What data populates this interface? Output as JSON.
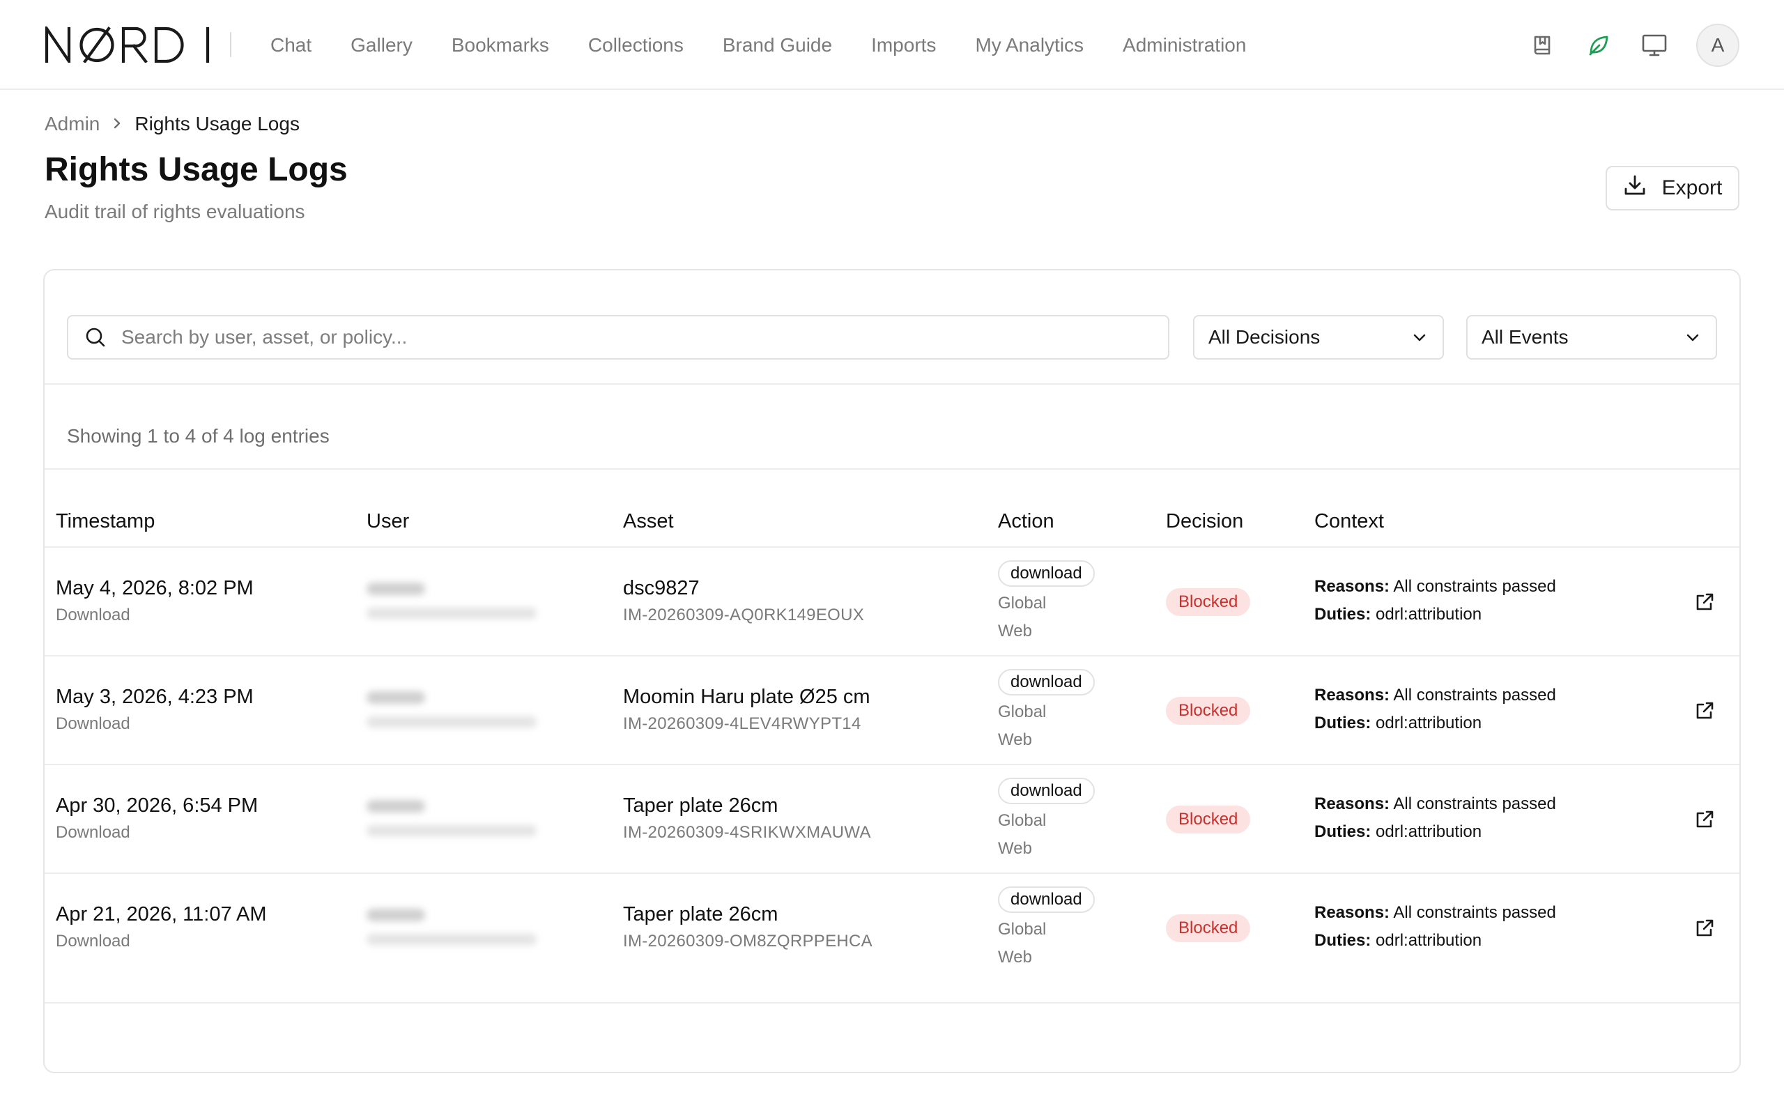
{
  "app": {
    "logo_text": "NØRDI",
    "nav": [
      "Chat",
      "Gallery",
      "Bookmarks",
      "Collections",
      "Brand Guide",
      "Imports",
      "My Analytics",
      "Administration"
    ],
    "icons": [
      "book-icon",
      "leaf-icon",
      "monitor-icon"
    ],
    "accent_color": "#1f9d55",
    "avatar_initial": "A"
  },
  "breadcrumb": {
    "root": "Admin",
    "separator": "›",
    "current": "Rights Usage Logs"
  },
  "page": {
    "title": "Rights Usage Logs",
    "subtitle": "Audit trail of rights evaluations",
    "export_label": "Export"
  },
  "filters": {
    "search_placeholder": "Search by user, asset, or policy...",
    "decision_selected": "All Decisions",
    "event_selected": "All Events"
  },
  "summary": "Showing 1 to 4 of 4 log entries",
  "table": {
    "columns": [
      "Timestamp",
      "User",
      "Asset",
      "Action",
      "Decision",
      "Context"
    ],
    "rows": [
      {
        "timestamp": "May 4, 2026, 8:02 PM",
        "event": "Download",
        "asset_name": "dsc9827",
        "asset_id": "IM-20260309-AQ0RK149EOUX",
        "action": "download",
        "scope": "Global",
        "channel": "Web",
        "decision": "Blocked",
        "reasons_label": "Reasons:",
        "reasons": "All constraints passed",
        "duties_label": "Duties:",
        "duties": "odrl:attribution"
      },
      {
        "timestamp": "May 3, 2026, 4:23 PM",
        "event": "Download",
        "asset_name": "Moomin Haru plate Ø25 cm",
        "asset_id": "IM-20260309-4LEV4RWYPT14",
        "action": "download",
        "scope": "Global",
        "channel": "Web",
        "decision": "Blocked",
        "reasons_label": "Reasons:",
        "reasons": "All constraints passed",
        "duties_label": "Duties:",
        "duties": "odrl:attribution"
      },
      {
        "timestamp": "Apr 30, 2026, 6:54 PM",
        "event": "Download",
        "asset_name": "Taper plate 26cm",
        "asset_id": "IM-20260309-4SRIKWXMAUWA",
        "action": "download",
        "scope": "Global",
        "channel": "Web",
        "decision": "Blocked",
        "reasons_label": "Reasons:",
        "reasons": "All constraints passed",
        "duties_label": "Duties:",
        "duties": "odrl:attribution"
      },
      {
        "timestamp": "Apr 21, 2026, 11:07 AM",
        "event": "Download",
        "asset_name": "Taper plate 26cm",
        "asset_id": "IM-20260309-OM8ZQRPPEHCA",
        "action": "download",
        "scope": "Global",
        "channel": "Web",
        "decision": "Blocked",
        "reasons_label": "Reasons:",
        "reasons": "All constraints passed",
        "duties_label": "Duties:",
        "duties": "odrl:attribution"
      }
    ]
  },
  "colors": {
    "blocked_bg": "#fde2e2",
    "blocked_text": "#c9302c",
    "muted_text": "#7a7a7a"
  }
}
